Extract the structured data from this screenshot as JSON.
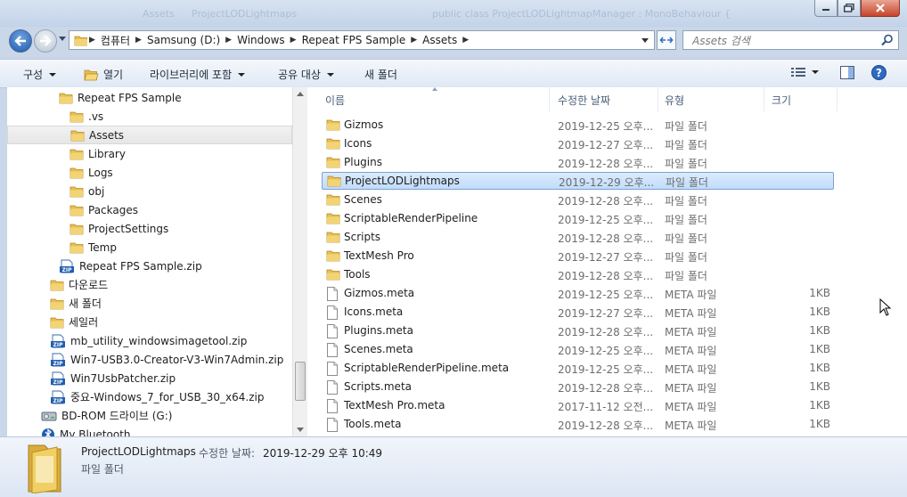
{
  "window": {
    "ghost_title_1": "Assets",
    "ghost_title_2": "ProjectLODLightmaps",
    "ghost_title_3": "public class ProjectLODLightmapManager : MonoBehaviour {"
  },
  "address": {
    "segments": [
      "컴퓨터",
      "Samsung (D:)",
      "Windows",
      "Repeat FPS Sample",
      "Assets"
    ]
  },
  "search": {
    "placeholder": "Assets 검색"
  },
  "toolbar": {
    "organize": "구성",
    "open": "열기",
    "include_in_library": "라이브러리에 포함",
    "share_with": "공유 대상",
    "new_folder": "새 폴더"
  },
  "tree": [
    {
      "label": "Repeat FPS Sample",
      "icon": "folder-icon"
    },
    {
      "label": ".vs",
      "icon": "folder-icon"
    },
    {
      "label": "Assets",
      "icon": "folder-icon",
      "selected": true
    },
    {
      "label": "Library",
      "icon": "folder-icon"
    },
    {
      "label": "Logs",
      "icon": "folder-icon"
    },
    {
      "label": "obj",
      "icon": "folder-icon"
    },
    {
      "label": "Packages",
      "icon": "folder-icon"
    },
    {
      "label": "ProjectSettings",
      "icon": "folder-icon"
    },
    {
      "label": "Temp",
      "icon": "folder-icon"
    },
    {
      "label": "Repeat FPS Sample.zip",
      "icon": "zip-icon"
    },
    {
      "label": "다운로드",
      "icon": "folder-icon"
    },
    {
      "label": "새 폴더",
      "icon": "folder-icon"
    },
    {
      "label": "세일러",
      "icon": "folder-icon"
    },
    {
      "label": "mb_utility_windowsimagetool.zip",
      "icon": "zip-icon"
    },
    {
      "label": "Win7-USB3.0-Creator-V3-Win7Admin.zip",
      "icon": "zip-icon"
    },
    {
      "label": "Win7UsbPatcher.zip",
      "icon": "zip-icon"
    },
    {
      "label": "중요-Windows_7_for_USB_30_x64.zip",
      "icon": "zip-icon"
    },
    {
      "label": "BD-ROM 드라이브 (G:)",
      "icon": "drive-icon"
    },
    {
      "label": "My Bluetooth",
      "icon": "bluetooth-icon"
    }
  ],
  "columns": {
    "name": "이름",
    "date": "수정한 날짜",
    "type": "유형",
    "size": "크기"
  },
  "files": [
    {
      "name": "Gizmos",
      "date": "2019-12-25 오후...",
      "type": "파일 폴더",
      "size": "",
      "icon": "folder-icon"
    },
    {
      "name": "Icons",
      "date": "2019-12-27 오후...",
      "type": "파일 폴더",
      "size": "",
      "icon": "folder-icon"
    },
    {
      "name": "Plugins",
      "date": "2019-12-28 오후...",
      "type": "파일 폴더",
      "size": "",
      "icon": "folder-icon"
    },
    {
      "name": "ProjectLODLightmaps",
      "date": "2019-12-29 오후...",
      "type": "파일 폴더",
      "size": "",
      "icon": "folder-icon",
      "selected": true
    },
    {
      "name": "Scenes",
      "date": "2019-12-28 오후...",
      "type": "파일 폴더",
      "size": "",
      "icon": "folder-icon"
    },
    {
      "name": "ScriptableRenderPipeline",
      "date": "2019-12-25 오후...",
      "type": "파일 폴더",
      "size": "",
      "icon": "folder-icon"
    },
    {
      "name": "Scripts",
      "date": "2019-12-28 오후...",
      "type": "파일 폴더",
      "size": "",
      "icon": "folder-icon"
    },
    {
      "name": "TextMesh Pro",
      "date": "2019-12-27 오후...",
      "type": "파일 폴더",
      "size": "",
      "icon": "folder-icon"
    },
    {
      "name": "Tools",
      "date": "2019-12-28 오후...",
      "type": "파일 폴더",
      "size": "",
      "icon": "folder-icon"
    },
    {
      "name": "Gizmos.meta",
      "date": "2019-12-25 오후...",
      "type": "META 파일",
      "size": "1KB",
      "icon": "file-icon"
    },
    {
      "name": "Icons.meta",
      "date": "2019-12-27 오후...",
      "type": "META 파일",
      "size": "1KB",
      "icon": "file-icon"
    },
    {
      "name": "Plugins.meta",
      "date": "2019-12-28 오후...",
      "type": "META 파일",
      "size": "1KB",
      "icon": "file-icon"
    },
    {
      "name": "Scenes.meta",
      "date": "2019-12-25 오후...",
      "type": "META 파일",
      "size": "1KB",
      "icon": "file-icon"
    },
    {
      "name": "ScriptableRenderPipeline.meta",
      "date": "2019-12-25 오후...",
      "type": "META 파일",
      "size": "1KB",
      "icon": "file-icon"
    },
    {
      "name": "Scripts.meta",
      "date": "2019-12-28 오후...",
      "type": "META 파일",
      "size": "1KB",
      "icon": "file-icon"
    },
    {
      "name": "TextMesh Pro.meta",
      "date": "2017-11-12 오전...",
      "type": "META 파일",
      "size": "1KB",
      "icon": "file-icon"
    },
    {
      "name": "Tools.meta",
      "date": "2019-12-28 오후...",
      "type": "META 파일",
      "size": "1KB",
      "icon": "file-icon"
    }
  ],
  "details": {
    "name": "ProjectLODLightmaps",
    "modified_label": "수정한 날짜:",
    "modified_value": "2019-12-29 오후 10:49",
    "type": "파일 폴더"
  },
  "colors": {
    "folder": "#e8bf52",
    "selection": "#cce4fc",
    "chrome": "#c9d7e8"
  }
}
